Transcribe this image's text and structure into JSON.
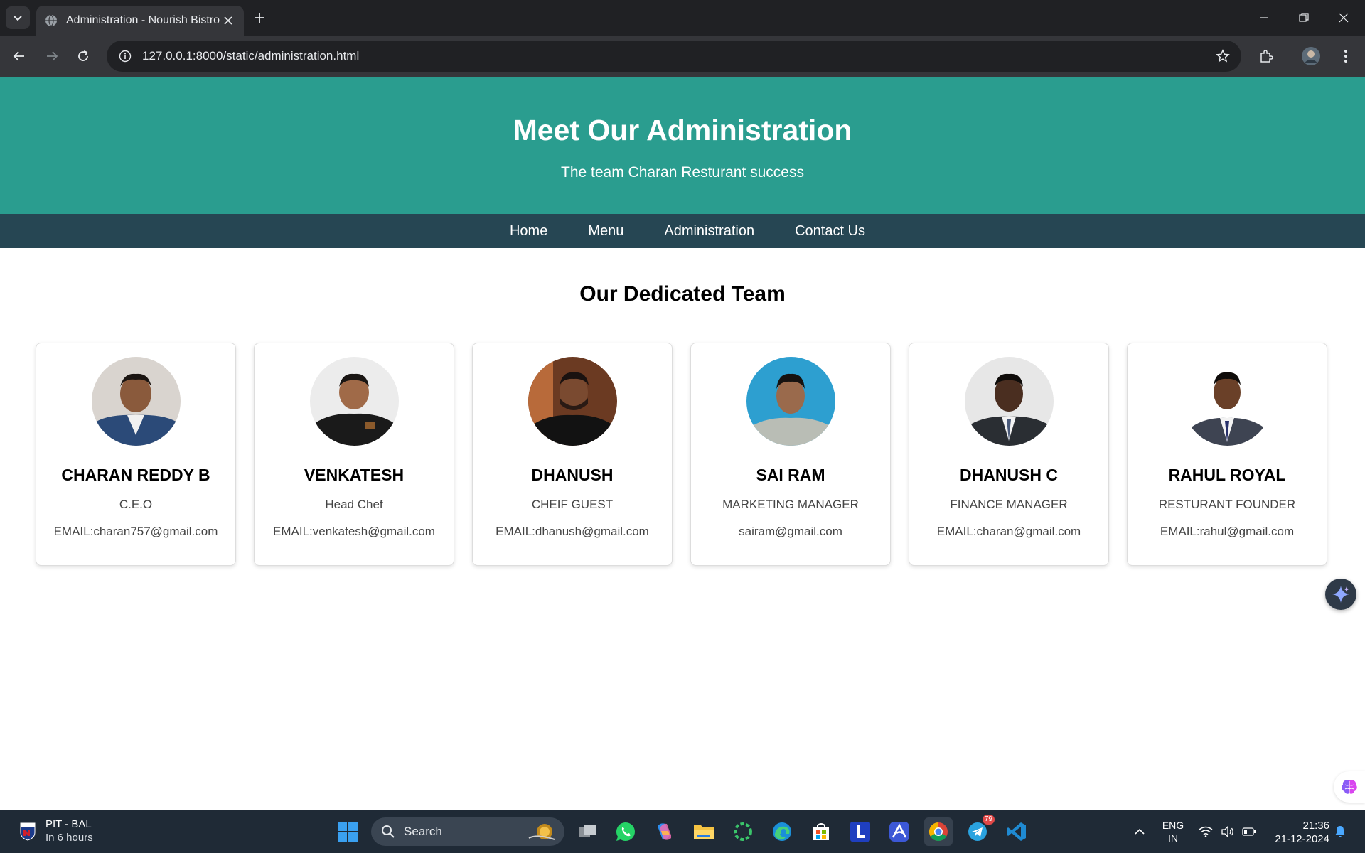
{
  "browser": {
    "tab_title": "Administration - Nourish Bistro",
    "url": "127.0.0.1:8000/static/administration.html"
  },
  "hero": {
    "title": "Meet Our Administration",
    "subtitle": "The team Charan Resturant success"
  },
  "nav": {
    "items": [
      {
        "label": "Home"
      },
      {
        "label": "Menu"
      },
      {
        "label": "Administration"
      },
      {
        "label": "Contact Us"
      }
    ]
  },
  "team": {
    "heading": "Our Dedicated Team",
    "members": [
      {
        "name": "CHARAN REDDY B",
        "role": "C.E.O",
        "email": "EMAIL:charan757@gmail.com"
      },
      {
        "name": "VENKATESH",
        "role": "Head Chef",
        "email": "EMAIL:venkatesh@gmail.com"
      },
      {
        "name": "DHANUSH",
        "role": "CHEIF GUEST",
        "email": "EMAIL:dhanush@gmail.com"
      },
      {
        "name": "SAI RAM",
        "role": "MARKETING MANAGER",
        "email": "sairam@gmail.com"
      },
      {
        "name": "DHANUSH C",
        "role": "FINANCE MANAGER",
        "email": "EMAIL:charan@gmail.com"
      },
      {
        "name": "RAHUL ROYAL",
        "role": "RESTURANT FOUNDER",
        "email": "EMAIL:rahul@gmail.com"
      }
    ]
  },
  "taskbar": {
    "weather_title": "PIT - BAL",
    "weather_sub": "In 6 hours",
    "search_label": "Search",
    "telegram_badge": "79",
    "lang_line1": "ENG",
    "lang_line2": "IN",
    "time": "21:36",
    "date": "21-12-2024"
  },
  "colors": {
    "hero_bg": "#2a9d8f",
    "nav_bg": "#264653"
  }
}
